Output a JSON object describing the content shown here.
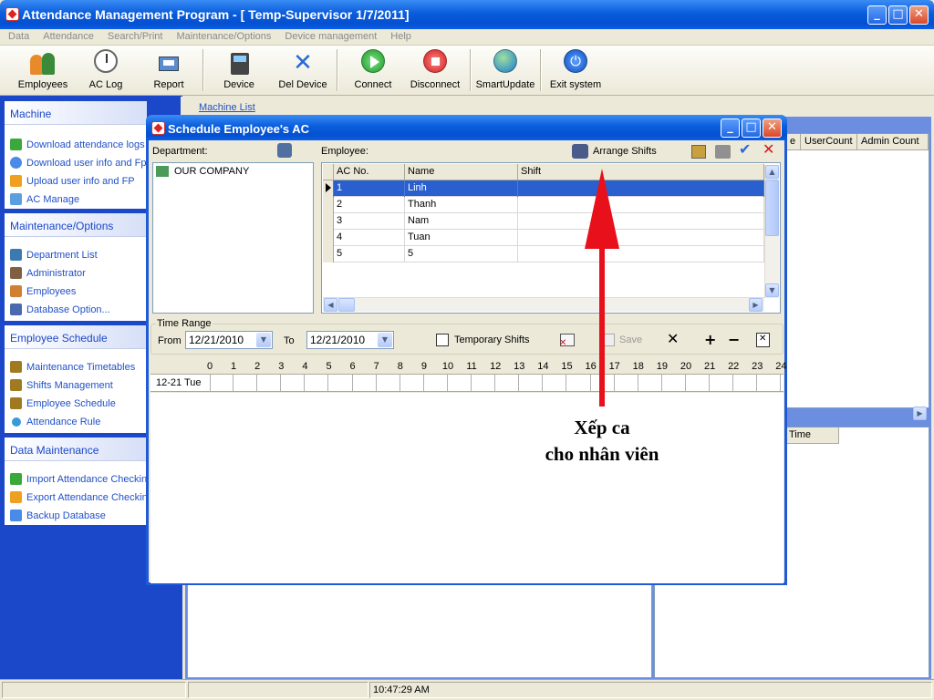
{
  "window": {
    "title": "Attendance Management Program - [ Temp-Supervisor 1/7/2011]"
  },
  "menu": [
    "Data",
    "Attendance",
    "Search/Print",
    "Maintenance/Options",
    "Device management",
    "Help"
  ],
  "toolbar": {
    "employees": "Employees",
    "ac_log": "AC Log",
    "report": "Report",
    "device": "Device",
    "del_device": "Del Device",
    "connect": "Connect",
    "disconnect": "Disconnect",
    "smart_update": "SmartUpdate",
    "exit": "Exit system"
  },
  "sidebar": {
    "machine": {
      "title": "Machine",
      "items": [
        "Download attendance logs",
        "Download user info and Fp",
        "Upload user info and FP",
        "AC Manage"
      ]
    },
    "maintenance": {
      "title": "Maintenance/Options",
      "items": [
        "Department List",
        "Administrator",
        "Employees",
        "Database Option..."
      ]
    },
    "schedule": {
      "title": "Employee Schedule",
      "items": [
        "Maintenance Timetables",
        "Shifts Management",
        "Employee Schedule",
        "Attendance Rule"
      ]
    },
    "data_maintenance": {
      "title": "Data Maintenance",
      "items": [
        "Import Attendance Checking",
        "Export Attendance Checking",
        "Backup Database"
      ]
    }
  },
  "machine_list": {
    "label": "Machine List",
    "columns": [
      "e",
      "UserCount",
      "Admin Count"
    ]
  },
  "log_panel": {
    "time_col": "Time"
  },
  "status": {
    "time": "10:47:29 AM"
  },
  "dialog": {
    "title": "Schedule Employee's AC",
    "department_label": "Department:",
    "department_root": "OUR COMPANY",
    "employee_label": "Employee:",
    "arrange_shifts": "Arrange Shifts",
    "grid": {
      "columns": [
        "AC No.",
        "Name",
        "Shift"
      ],
      "rows": [
        {
          "ac": "1",
          "name": "Linh",
          "shift": ""
        },
        {
          "ac": "2",
          "name": "Thanh",
          "shift": ""
        },
        {
          "ac": "3",
          "name": "Nam",
          "shift": ""
        },
        {
          "ac": "4",
          "name": "Tuan",
          "shift": ""
        },
        {
          "ac": "5",
          "name": "5",
          "shift": ""
        }
      ]
    },
    "time_range": {
      "label": "Time Range",
      "from_label": "From",
      "from_value": "12/21/2010",
      "to_label": "To",
      "to_value": "12/21/2010"
    },
    "temporary_shifts": "Temporary Shifts",
    "save": "Save",
    "hours": [
      "0",
      "1",
      "2",
      "3",
      "4",
      "5",
      "6",
      "7",
      "8",
      "9",
      "10",
      "11",
      "12",
      "13",
      "14",
      "15",
      "16",
      "17",
      "18",
      "19",
      "20",
      "21",
      "22",
      "23",
      "24"
    ],
    "day_label": "12-21 Tue"
  },
  "annotation": {
    "line1": "Xếp ca",
    "line2": "cho nhân viên",
    "color": "#e8101a"
  }
}
